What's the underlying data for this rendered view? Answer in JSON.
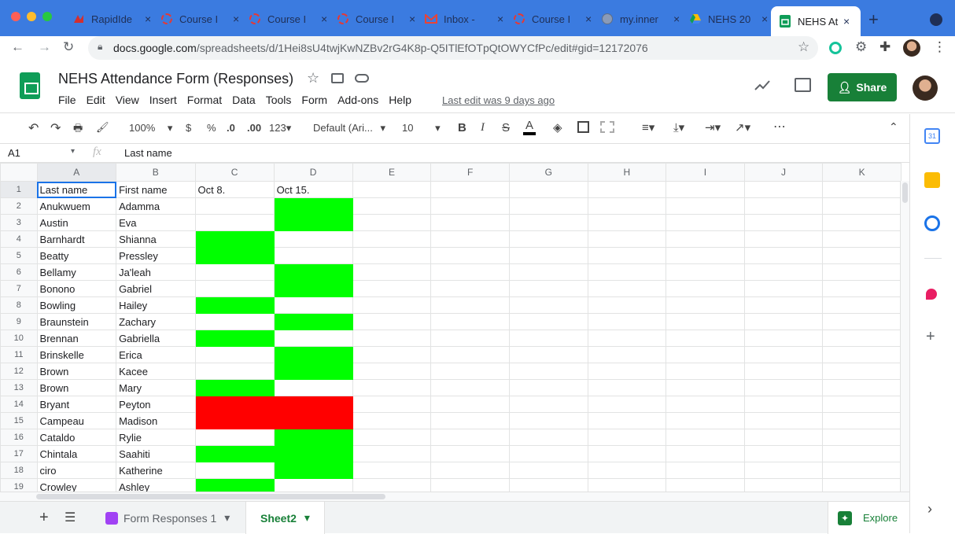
{
  "browser": {
    "tabs": [
      {
        "title": "RapidIde",
        "icon": "rapididentity-icon"
      },
      {
        "title": "Course I",
        "icon": "course-icon"
      },
      {
        "title": "Course I",
        "icon": "course-icon"
      },
      {
        "title": "Course I",
        "icon": "course-icon"
      },
      {
        "title": "Inbox - ",
        "icon": "gmail-icon"
      },
      {
        "title": "Course I",
        "icon": "course-icon"
      },
      {
        "title": "my.inner",
        "icon": "globe-icon"
      },
      {
        "title": "NEHS 20",
        "icon": "drive-icon"
      },
      {
        "title": "NEHS At",
        "icon": "sheets-icon"
      }
    ],
    "url_host": "docs.google.com",
    "url_path": "/spreadsheets/d/1Hei8sU4twjKwNZBv2rG4K8p-Q5ITlEfOTpQtOWYCfPc/edit#gid=12172076"
  },
  "doc": {
    "title": "NEHS Attendance Form (Responses)",
    "menus": [
      "File",
      "Edit",
      "View",
      "Insert",
      "Format",
      "Data",
      "Tools",
      "Form",
      "Add-ons",
      "Help"
    ],
    "last_edit": "Last edit was 9 days ago",
    "share_label": "Share"
  },
  "toolbar": {
    "zoom": "100%",
    "currency": "$",
    "percent": "%",
    "dec_decrease": ".0",
    "dec_increase": ".00",
    "more_formats": "123",
    "font": "Default (Ari...",
    "font_size": "10",
    "bold": "B",
    "italic": "I",
    "strike": "S",
    "text_color": "A"
  },
  "formula_bar": {
    "cell_ref": "A1",
    "fx": "fx",
    "value": "Last name"
  },
  "columns": [
    "A",
    "B",
    "C",
    "D",
    "E",
    "F",
    "G",
    "H",
    "I",
    "J",
    "K"
  ],
  "rows": [
    {
      "n": "1",
      "a": "Last name",
      "b": "First name",
      "c": "Oct 8.",
      "d": "Oct 15.",
      "cf": "",
      "df": ""
    },
    {
      "n": "2",
      "a": "Anukwuem",
      "b": "Adamma",
      "c": "",
      "d": "",
      "cf": "",
      "df": "g"
    },
    {
      "n": "3",
      "a": "Austin",
      "b": "Eva",
      "c": "",
      "d": "",
      "cf": "",
      "df": "g"
    },
    {
      "n": "4",
      "a": "Barnhardt",
      "b": "Shianna",
      "c": "",
      "d": "",
      "cf": "g",
      "df": ""
    },
    {
      "n": "5",
      "a": "Beatty",
      "b": "Pressley",
      "c": "",
      "d": "",
      "cf": "g",
      "df": ""
    },
    {
      "n": "6",
      "a": "Bellamy",
      "b": "Ja'leah",
      "c": "",
      "d": "",
      "cf": "",
      "df": "g"
    },
    {
      "n": "7",
      "a": "Bonono",
      "b": "Gabriel",
      "c": "",
      "d": "",
      "cf": "",
      "df": "g"
    },
    {
      "n": "8",
      "a": "Bowling",
      "b": "Hailey",
      "c": "",
      "d": "",
      "cf": "g",
      "df": ""
    },
    {
      "n": "9",
      "a": "Braunstein",
      "b": "Zachary",
      "c": "",
      "d": "",
      "cf": "",
      "df": "g"
    },
    {
      "n": "10",
      "a": "Brennan",
      "b": "Gabriella",
      "c": "",
      "d": "",
      "cf": "g",
      "df": ""
    },
    {
      "n": "11",
      "a": "Brinskelle",
      "b": "Erica",
      "c": "",
      "d": "",
      "cf": "",
      "df": "g"
    },
    {
      "n": "12",
      "a": "Brown",
      "b": "Kacee",
      "c": "",
      "d": "",
      "cf": "",
      "df": "g"
    },
    {
      "n": "13",
      "a": "Brown",
      "b": "Mary",
      "c": "",
      "d": "",
      "cf": "g",
      "df": ""
    },
    {
      "n": "14",
      "a": "Bryant",
      "b": "Peyton",
      "c": "",
      "d": "",
      "cf": "r",
      "df": "r"
    },
    {
      "n": "15",
      "a": "Campeau",
      "b": "Madison",
      "c": "",
      "d": "",
      "cf": "r",
      "df": "r"
    },
    {
      "n": "16",
      "a": "Cataldo",
      "b": "Rylie",
      "c": "",
      "d": "",
      "cf": "",
      "df": "g"
    },
    {
      "n": "17",
      "a": "Chintala",
      "b": "Saahiti",
      "c": "",
      "d": "",
      "cf": "g",
      "df": "g"
    },
    {
      "n": "18",
      "a": "ciro",
      "b": "Katherine",
      "c": "",
      "d": "",
      "cf": "",
      "df": "g"
    },
    {
      "n": "19",
      "a": "Crowley",
      "b": "Ashley",
      "c": "",
      "d": "",
      "cf": "g",
      "df": ""
    }
  ],
  "sheets": {
    "tab1": "Form Responses 1",
    "tab2": "Sheet2",
    "explore": "Explore"
  },
  "colors": {
    "present": "#00ff00",
    "absent": "#ff0000",
    "accent": "#188038"
  }
}
